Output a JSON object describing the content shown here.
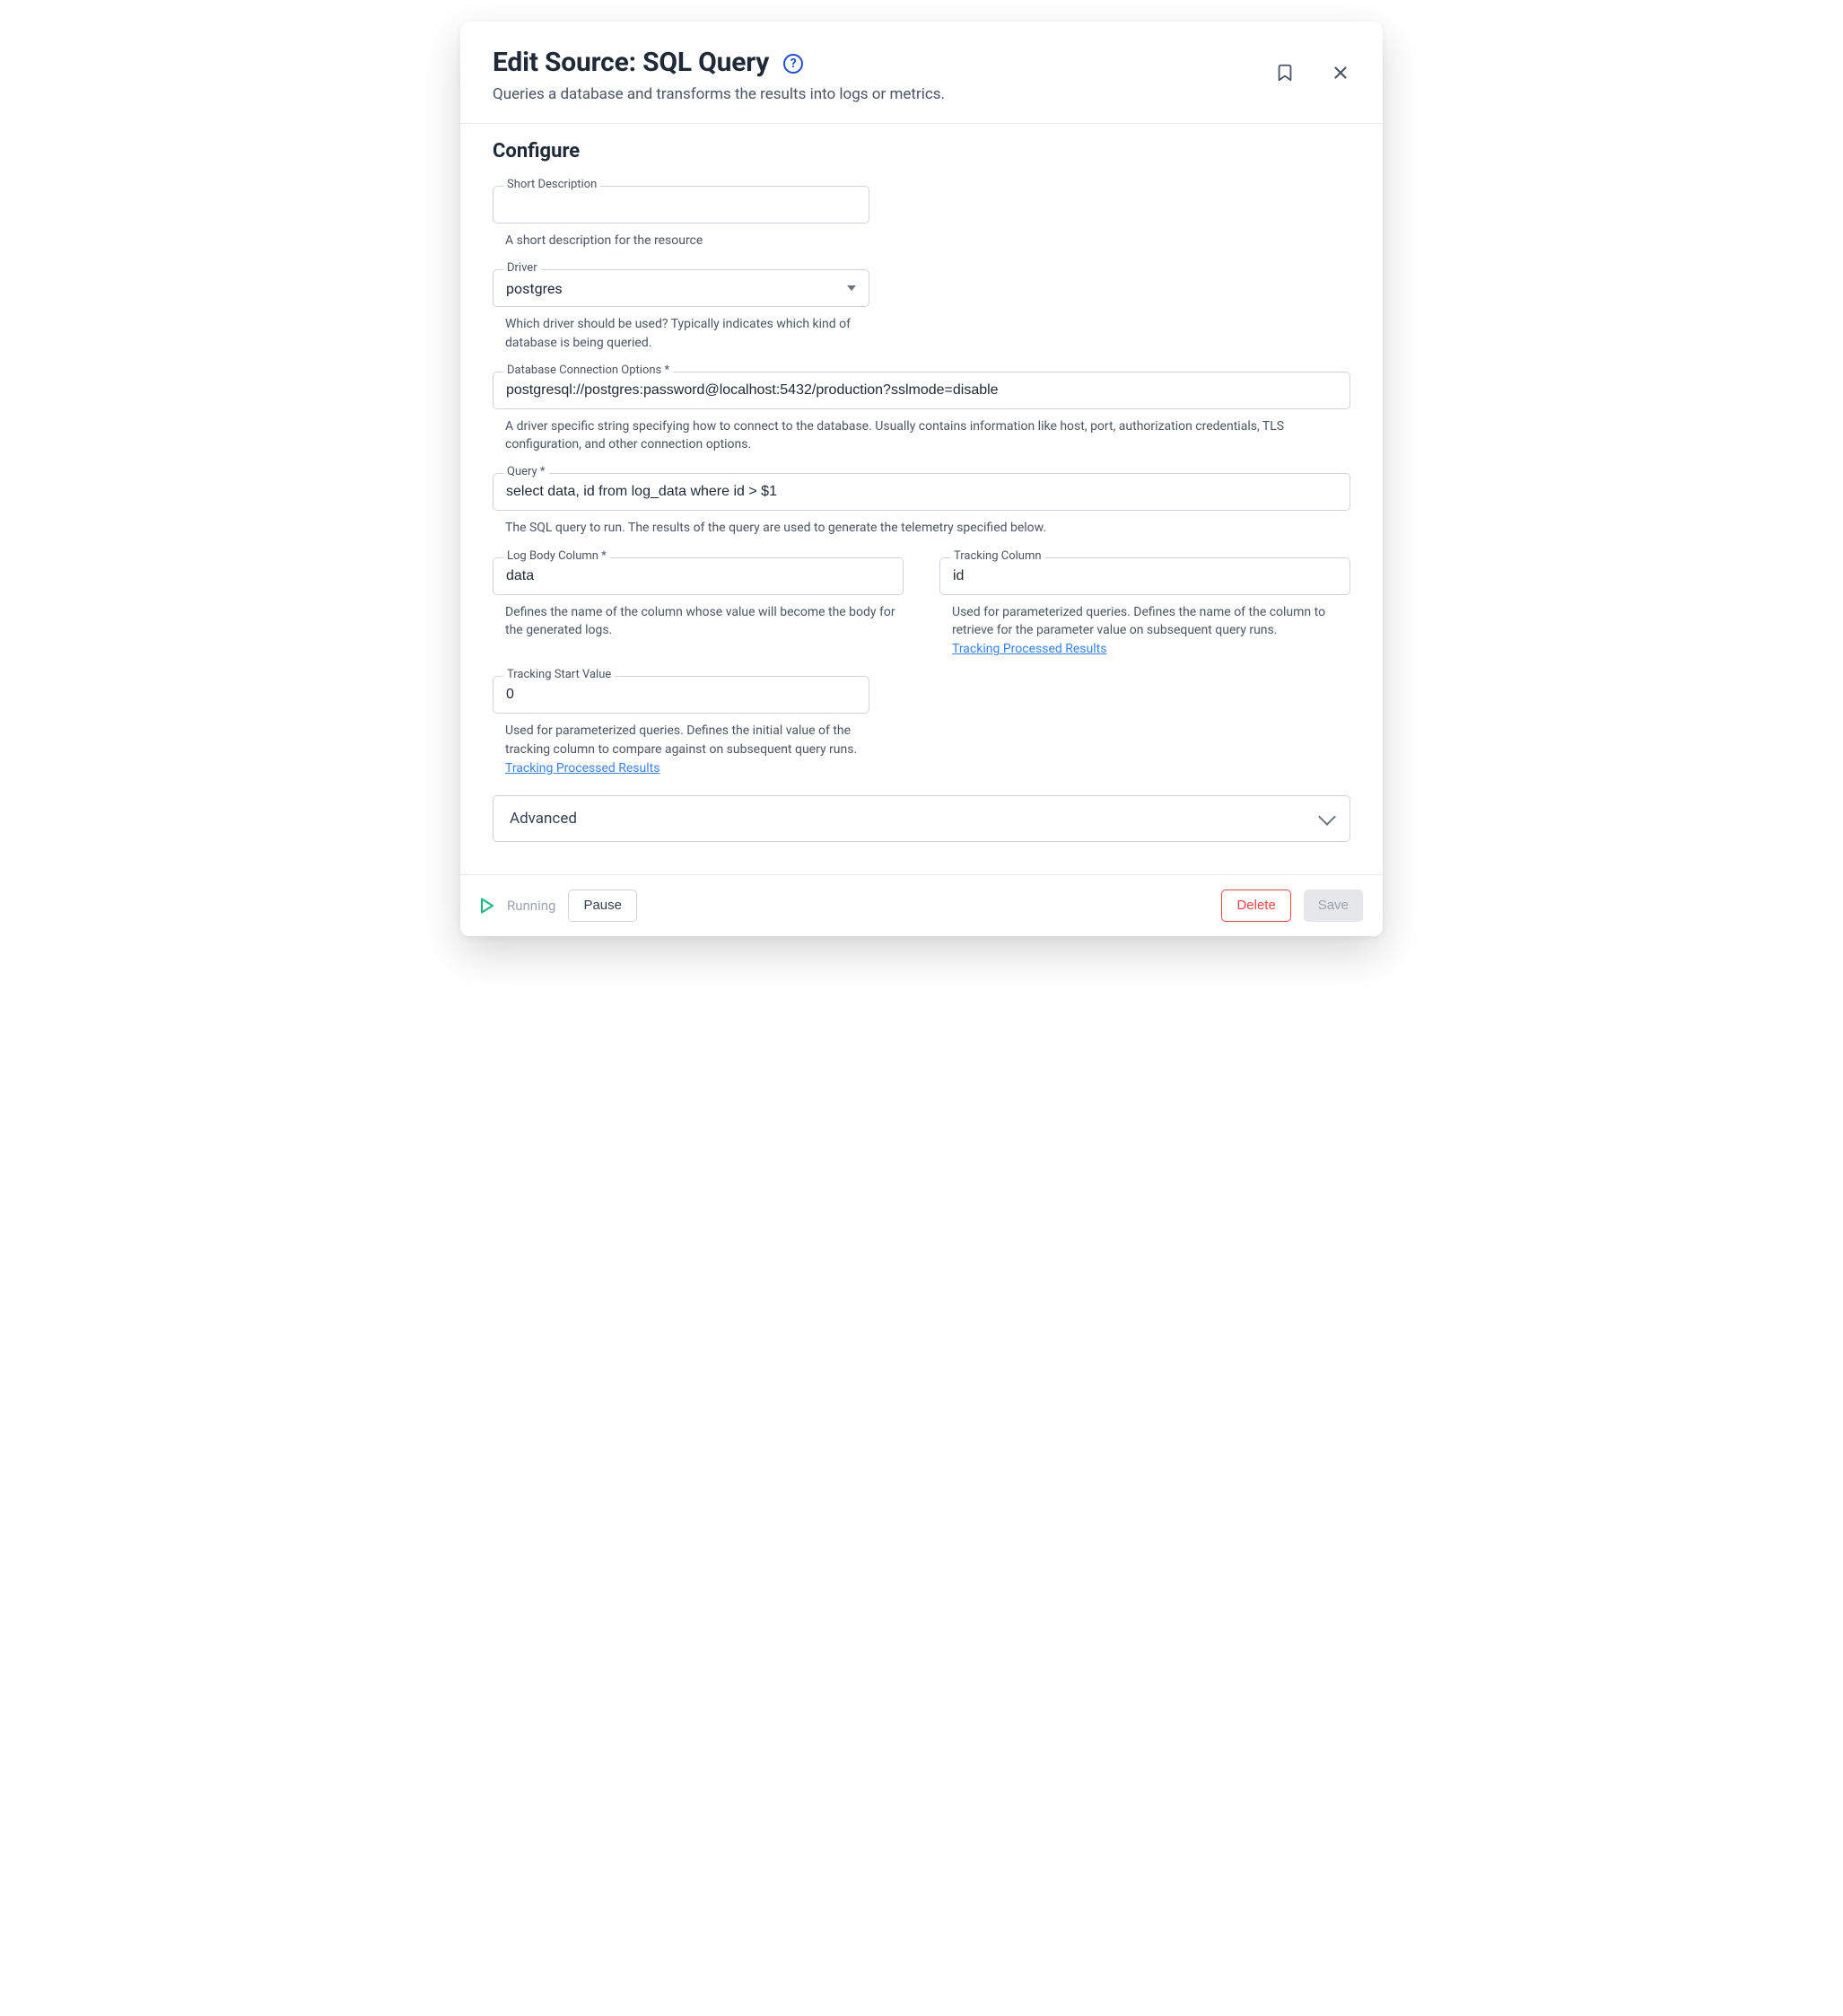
{
  "header": {
    "title": "Edit Source: SQL Query",
    "subtitle": "Queries a database and transforms the results into logs or metrics."
  },
  "section_title": "Configure",
  "fields": {
    "short_description": {
      "label": "Short Description",
      "value": "",
      "helper": "A short description for the resource"
    },
    "driver": {
      "label": "Driver",
      "value": "postgres",
      "helper": "Which driver should be used? Typically indicates which kind of database is being queried."
    },
    "connection": {
      "label": "Database Connection Options *",
      "value": "postgresql://postgres:password@localhost:5432/production?sslmode=disable",
      "helper": "A driver specific string specifying how to connect to the database. Usually contains information like host, port, authorization credentials, TLS configuration, and other connection options."
    },
    "query": {
      "label": "Query *",
      "value": "select data, id from log_data where id > $1",
      "helper": "The SQL query to run. The results of the query are used to generate the telemetry specified below."
    },
    "log_body_column": {
      "label": "Log Body Column *",
      "value": "data",
      "helper": "Defines the name of the column whose value will become the body for the generated logs."
    },
    "tracking_column": {
      "label": "Tracking Column",
      "value": "id",
      "helper": "Used for parameterized queries. Defines the name of the column to retrieve for the parameter value on subsequent query runs.",
      "link": "Tracking Processed Results"
    },
    "tracking_start_value": {
      "label": "Tracking Start Value",
      "value": "0",
      "helper": "Used for parameterized queries. Defines the initial value of the tracking column to compare against on subsequent query runs.",
      "link": "Tracking Processed Results"
    }
  },
  "accordion": {
    "advanced": "Advanced"
  },
  "footer": {
    "status": "Running",
    "pause": "Pause",
    "delete": "Delete",
    "save": "Save"
  }
}
